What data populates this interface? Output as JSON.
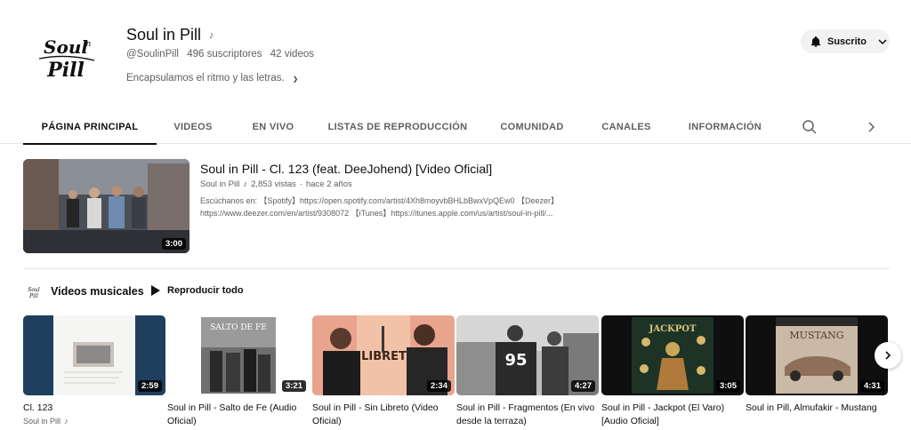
{
  "channel": {
    "name": "Soul in Pill",
    "handle": "@SoulinPill",
    "subscribers": "496 suscriptores",
    "videos": "42 videos",
    "description": "Encapsulamos el ritmo y las letras.",
    "subscribe_label": "Suscrito",
    "logo_text": "Soul in Pill"
  },
  "tabs": [
    {
      "label": "PÁGINA PRINCIPAL",
      "active": true
    },
    {
      "label": "VIDEOS"
    },
    {
      "label": "EN VIVO"
    },
    {
      "label": "LISTAS DE REPRODUCCIÓN"
    },
    {
      "label": "COMUNIDAD"
    },
    {
      "label": "CANALES"
    },
    {
      "label": "INFORMACIÓN"
    }
  ],
  "featured": {
    "title": "Soul in Pill - Cl. 123 (feat. DeeJohend) [Video Oficial]",
    "channel": "Soul in Pill",
    "views": "2,853 vistas",
    "age": "hace 2 años",
    "duration": "3:00",
    "description_line1": "Escúchanos en: 【Spotify】https://open.spotify.com/artist/4Xh8moyvbBHLbBwxVpQEw0 【Deezer】",
    "description_line2": "https://www.deezer.com/en/artist/9308072 【iTunes】https://itunes.apple.com/us/artist/soul-in-pill/..."
  },
  "section": {
    "title": "Videos musicales",
    "play_all": "Reproducir todo"
  },
  "videos": [
    {
      "title": "Cl. 123",
      "duration": "2:59",
      "channel": "Soul in Pill"
    },
    {
      "title": "Soul in Pill - Salto de Fe (Audio Oficial)",
      "duration": "3:21",
      "thumb_text": "SALTO DE FE"
    },
    {
      "title": "Soul in Pill - Sin Libreto (Video Oficial)",
      "duration": "2:34",
      "thumb_text": "LIBRETO"
    },
    {
      "title": "Soul in Pill - Fragmentos (En vivo desde la terraza)",
      "duration": "4:27",
      "thumb_text": "95"
    },
    {
      "title": "Soul in Pill - Jackpot (El Varo) [Audio Oficial]",
      "duration": "3:05",
      "thumb_text": "JACKPOT"
    },
    {
      "title": "Soul in Pill, Almufakir - Mustang",
      "duration": "4:31",
      "thumb_text": "MUSTANG"
    }
  ],
  "colors": {
    "text_primary": "#0f0f0f",
    "text_secondary": "#606060",
    "chip_bg": "#f2f2f2"
  }
}
